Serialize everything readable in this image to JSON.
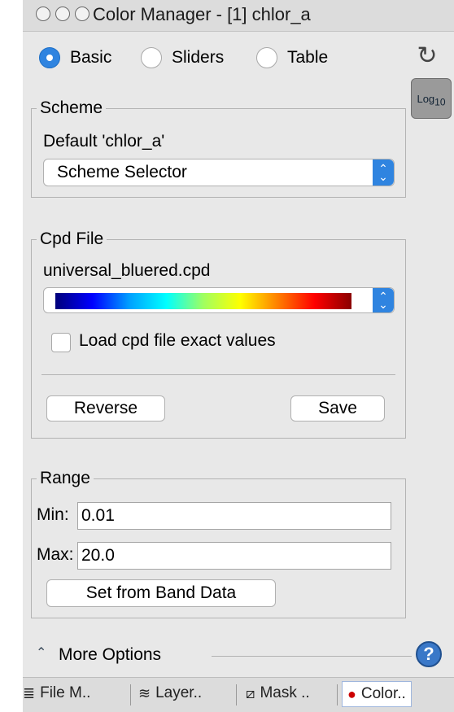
{
  "window": {
    "title": "Color Manager - [1] chlor_a"
  },
  "mode": {
    "options": [
      "Basic",
      "Sliders",
      "Table"
    ],
    "selected": "Basic"
  },
  "toolbar": {
    "log_button": "Log",
    "log_base": "10"
  },
  "scheme": {
    "legend": "Scheme",
    "default_text": "Default 'chlor_a'",
    "selector_value": "Scheme Selector"
  },
  "cpd": {
    "legend": "Cpd File",
    "filename": "universal_bluered.cpd",
    "palette_colors": [
      "#00007a",
      "#0000ff",
      "#00a0ff",
      "#00ffff",
      "#a0ff60",
      "#ffff00",
      "#ff8000",
      "#ff0000",
      "#8a0000"
    ],
    "load_exact_label": "Load cpd file exact values",
    "load_exact_checked": false,
    "reverse_label": "Reverse",
    "save_label": "Save"
  },
  "range": {
    "legend": "Range",
    "min_label": "Min:",
    "min_value": "0.01",
    "max_label": "Max:",
    "max_value": "20.0",
    "set_from_band_label": "Set from Band Data"
  },
  "more_options": {
    "label": "More Options"
  },
  "tabs": [
    {
      "label": "File M..",
      "icon": "database-icon"
    },
    {
      "label": "Layer..",
      "icon": "layers-icon"
    },
    {
      "label": "Mask ..",
      "icon": "mask-icon"
    },
    {
      "label": "Color..",
      "icon": "color-icon",
      "active": true
    }
  ],
  "colors": {
    "accent": "#2f84e0",
    "panel": "#e8e8e8"
  }
}
